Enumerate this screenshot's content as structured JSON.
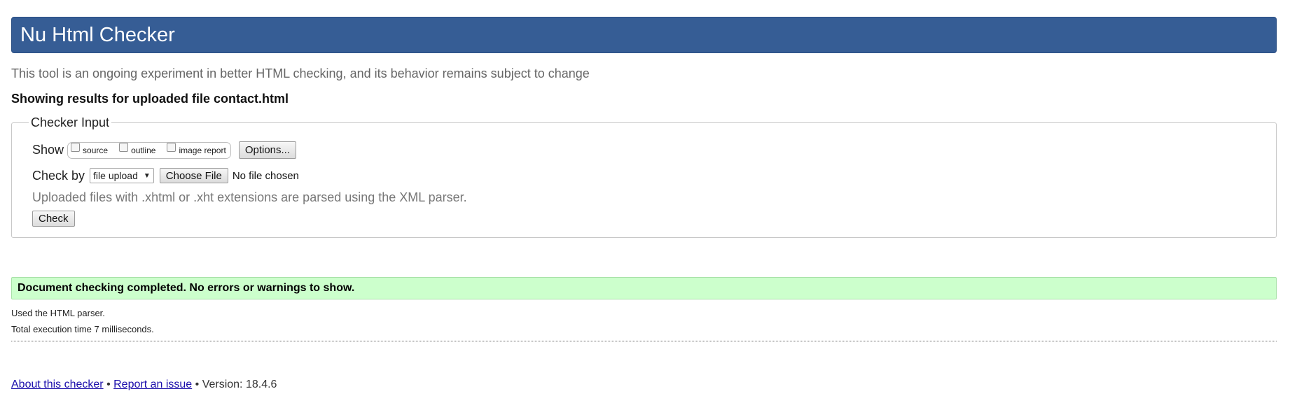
{
  "header": {
    "title": "Nu Html Checker"
  },
  "tagline": "This tool is an ongoing experiment in better HTML checking, and its behavior remains subject to change",
  "results_for": "Showing results for uploaded file contact.html",
  "checker_input": {
    "legend": "Checker Input",
    "show_label": "Show",
    "show_options": [
      {
        "label": "source",
        "checked": false
      },
      {
        "label": "outline",
        "checked": false
      },
      {
        "label": "image report",
        "checked": false
      }
    ],
    "options_button": "Options...",
    "check_by_label": "Check by",
    "check_by_value": "file upload",
    "choose_file_button": "Choose File",
    "no_file_text": "No file chosen",
    "note": "Uploaded files with .xhtml or .xht extensions are parsed using the XML parser.",
    "check_button": "Check"
  },
  "result": {
    "success_message": "Document checking completed. No errors or warnings to show.",
    "parser_info": "Used the HTML parser.",
    "execution_time": "Total execution time 7 milliseconds."
  },
  "footer": {
    "about_link": "About this checker",
    "separator1": " • ",
    "report_link": "Report an issue",
    "separator2": " • ",
    "version": "Version: 18.4.6"
  },
  "colors": {
    "header_bg": "#365d95",
    "success_bg": "#ccffcc",
    "link": "#1a0dab"
  }
}
